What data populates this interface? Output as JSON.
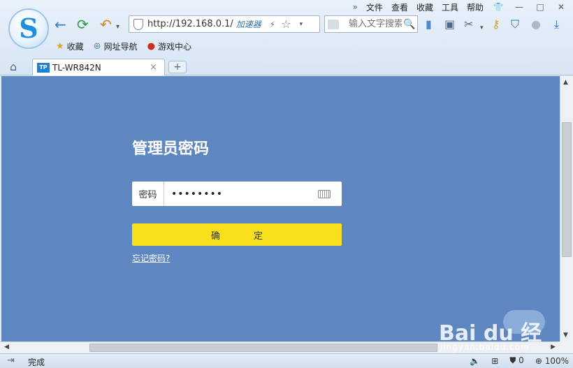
{
  "browser": {
    "menu": {
      "overflow": "»",
      "items": [
        "文件",
        "查看",
        "收藏",
        "工具",
        "帮助"
      ],
      "skin_icon": "shirt-icon"
    },
    "window_controls": {
      "minimize": "—",
      "maximize": "□",
      "close": "✕"
    },
    "nav": {
      "back": "←",
      "refresh": "⟳",
      "undo": "↶",
      "dropdown": "▾"
    },
    "address_bar": {
      "url": "http://192.168.0.1/",
      "accelerator": "加速器",
      "bolt": "⚡",
      "star": "☆",
      "dropdown": "▾"
    },
    "search": {
      "placeholder": "输入文字搜索",
      "icon": "🔍"
    },
    "bookmarks": [
      {
        "label": "收藏",
        "icon": "★",
        "color": "#e8a317"
      },
      {
        "label": "网址导航",
        "icon": "⊕",
        "color": "#6a8ab0"
      },
      {
        "label": "游戏中心",
        "icon": "●",
        "color": "#d42a1a"
      }
    ],
    "tab": {
      "favicon": "TP",
      "title": "TL-WR842N",
      "close": "×",
      "new_tab": "+"
    },
    "home_icon": "⌂",
    "toolbar_icons": [
      "bookmark-icon",
      "screenshot-icon",
      "scissors-icon",
      "key-icon",
      "shield-icon",
      "more-icon",
      "download-icon"
    ]
  },
  "page": {
    "title": "管理员密码",
    "password_label": "密码",
    "password_value": "••••••••",
    "confirm_label": "确 定",
    "forgot_label": "忘记密码?",
    "colors": {
      "background": "#5e87c1",
      "button": "#f9e01c"
    }
  },
  "status_bar": {
    "text": "完成",
    "volume": "🔈",
    "security_count": "0",
    "zoom": "100%"
  },
  "watermark": {
    "brand": "Bai du 经验",
    "url": "jingyan.baidu.com"
  }
}
